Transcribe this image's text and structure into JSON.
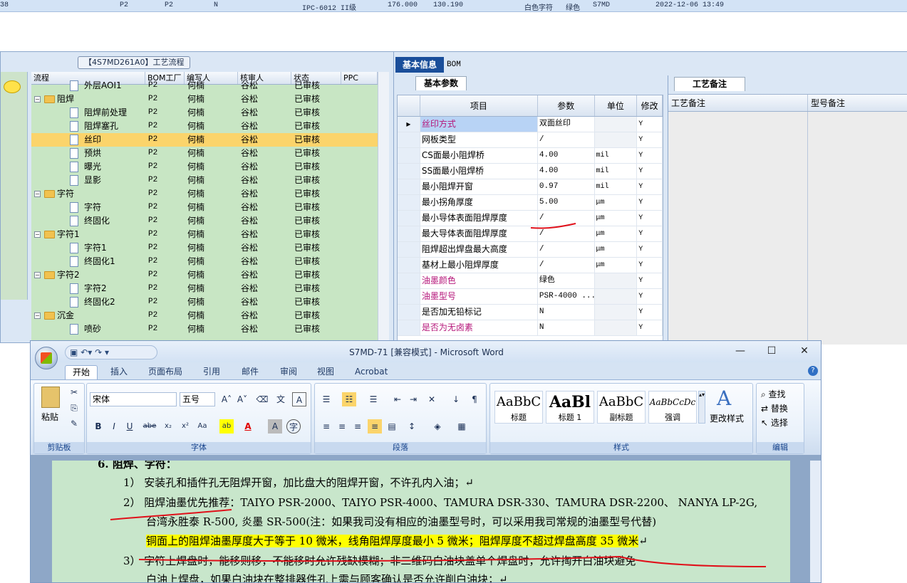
{
  "top_strip": {
    "cells": [
      "38",
      "P2",
      "P2",
      "N",
      "IPC-6012 II级",
      "176.000",
      "130.190",
      "白色字符",
      "绿色",
      "S7MD",
      "2022-12-06 13:49"
    ]
  },
  "flow_panel": {
    "title": "【4S7MD261A0】工艺流程",
    "columns": [
      "流程",
      "BOM工厂",
      "编写人",
      "核审人",
      "状态",
      "PPC"
    ],
    "rows": [
      {
        "name": "外层AOI1",
        "level": 2,
        "type": "doc",
        "bom": "P2",
        "writer": "何楠",
        "reviewer": "谷松",
        "status": "已审核"
      },
      {
        "name": "阻焊",
        "level": 1,
        "type": "folder",
        "bom": "P2",
        "writer": "何楠",
        "reviewer": "谷松",
        "status": "已审核"
      },
      {
        "name": "阻焊前处理",
        "level": 2,
        "type": "doc",
        "bom": "P2",
        "writer": "何楠",
        "reviewer": "谷松",
        "status": "已审核"
      },
      {
        "name": "阻焊塞孔",
        "level": 2,
        "type": "doc",
        "bom": "P2",
        "writer": "何楠",
        "reviewer": "谷松",
        "status": "已审核"
      },
      {
        "name": "丝印",
        "level": 2,
        "type": "doc",
        "bom": "P2",
        "writer": "何楠",
        "reviewer": "谷松",
        "status": "已审核",
        "selected": true
      },
      {
        "name": "预烘",
        "level": 2,
        "type": "doc",
        "bom": "P2",
        "writer": "何楠",
        "reviewer": "谷松",
        "status": "已审核"
      },
      {
        "name": "曝光",
        "level": 2,
        "type": "doc",
        "bom": "P2",
        "writer": "何楠",
        "reviewer": "谷松",
        "status": "已审核"
      },
      {
        "name": "显影",
        "level": 2,
        "type": "doc",
        "bom": "P2",
        "writer": "何楠",
        "reviewer": "谷松",
        "status": "已审核"
      },
      {
        "name": "字符",
        "level": 1,
        "type": "folder",
        "bom": "P2",
        "writer": "何楠",
        "reviewer": "谷松",
        "status": "已审核"
      },
      {
        "name": "字符",
        "level": 2,
        "type": "doc",
        "bom": "P2",
        "writer": "何楠",
        "reviewer": "谷松",
        "status": "已审核"
      },
      {
        "name": "终固化",
        "level": 2,
        "type": "doc",
        "bom": "P2",
        "writer": "何楠",
        "reviewer": "谷松",
        "status": "已审核"
      },
      {
        "name": "字符1",
        "level": 1,
        "type": "folder",
        "bom": "P2",
        "writer": "何楠",
        "reviewer": "谷松",
        "status": "已审核"
      },
      {
        "name": "字符1",
        "level": 2,
        "type": "doc",
        "bom": "P2",
        "writer": "何楠",
        "reviewer": "谷松",
        "status": "已审核"
      },
      {
        "name": "终固化1",
        "level": 2,
        "type": "doc",
        "bom": "P2",
        "writer": "何楠",
        "reviewer": "谷松",
        "status": "已审核"
      },
      {
        "name": "字符2",
        "level": 1,
        "type": "folder",
        "bom": "P2",
        "writer": "何楠",
        "reviewer": "谷松",
        "status": "已审核"
      },
      {
        "name": "字符2",
        "level": 2,
        "type": "doc",
        "bom": "P2",
        "writer": "何楠",
        "reviewer": "谷松",
        "status": "已审核"
      },
      {
        "name": "终固化2",
        "level": 2,
        "type": "doc",
        "bom": "P2",
        "writer": "何楠",
        "reviewer": "谷松",
        "status": "已审核"
      },
      {
        "name": "沉金",
        "level": 1,
        "type": "folder",
        "bom": "P2",
        "writer": "何楠",
        "reviewer": "谷松",
        "status": "已审核"
      },
      {
        "name": "喷砂",
        "level": 2,
        "type": "doc",
        "bom": "P2",
        "writer": "何楠",
        "reviewer": "谷松",
        "status": "已审核"
      }
    ]
  },
  "info_panel": {
    "tabs": [
      "基本信息",
      "BOM"
    ],
    "subtab": "基本参数",
    "columns": [
      "项目",
      "参数",
      "单位",
      "修改"
    ],
    "rows": [
      {
        "item": "丝印方式",
        "value": "双面丝印",
        "unit": "",
        "mod": "Y",
        "pink": true,
        "current": true
      },
      {
        "item": "网板类型",
        "value": "/",
        "unit": "",
        "mod": "Y"
      },
      {
        "item": "CS面最小阻焊桥",
        "value": "4.00",
        "unit": "mil",
        "mod": "Y"
      },
      {
        "item": "SS面最小阻焊桥",
        "value": "4.00",
        "unit": "mil",
        "mod": "Y"
      },
      {
        "item": "最小阻焊开窗",
        "value": "0.97",
        "unit": "mil",
        "mod": "Y"
      },
      {
        "item": "最小拐角厚度",
        "value": "5.00",
        "unit": "μm",
        "mod": "Y"
      },
      {
        "item": "最小导体表面阻焊厚度",
        "value": "/",
        "unit": "μm",
        "mod": "Y"
      },
      {
        "item": "最大导体表面阻焊厚度",
        "value": "/",
        "unit": "μm",
        "mod": "Y"
      },
      {
        "item": "阻焊超出焊盘最大高度",
        "value": "/",
        "unit": "μm",
        "mod": "Y"
      },
      {
        "item": "基材上最小阻焊厚度",
        "value": "/",
        "unit": "μm",
        "mod": "Y"
      },
      {
        "item": "油墨颜色",
        "value": "绿色",
        "unit": "",
        "mod": "Y",
        "pink": true
      },
      {
        "item": "油墨型号",
        "value": "PSR-4000 ...",
        "unit": "",
        "mod": "Y",
        "pink": true
      },
      {
        "item": "是否加无铅标记",
        "value": "N",
        "unit": "",
        "mod": "Y"
      },
      {
        "item": "是否为无卤素",
        "value": "N",
        "unit": "",
        "mod": "Y",
        "pink": true
      }
    ],
    "notes_tab": "工艺备注",
    "notes_columns": [
      "工艺备注",
      "型号备注"
    ]
  },
  "word": {
    "title": "S7MD-71 [兼容模式] - Microsoft Word",
    "tabs": [
      "开始",
      "插入",
      "页面布局",
      "引用",
      "邮件",
      "审阅",
      "视图",
      "Acrobat"
    ],
    "font_name": "宋体",
    "font_size": "五号",
    "groups": {
      "clipboard": "剪贴板",
      "font": "字体",
      "paragraph": "段落",
      "styles": "样式",
      "editing": "编辑"
    },
    "paste_label": "粘贴",
    "styles": [
      {
        "preview": "AaBbC",
        "label": "标题"
      },
      {
        "preview": "AaBl",
        "label": "标题 1"
      },
      {
        "preview": "AaBbC",
        "label": "副标题"
      },
      {
        "preview": "AaBbCcDc",
        "label": "强调"
      }
    ],
    "change_styles": "更改样式",
    "editing": [
      "查找",
      "替换",
      "选择"
    ],
    "doc_lines": {
      "heading": "6.   阻焊、字符：",
      "l1": "1）  安装孔和插件孔无阻焊开窗，加比盘大的阻焊开窗，不许孔内入油；↵",
      "l2": "2）  阻焊油墨优先推荐：TAIYO PSR-2000、TAIYO PSR-4000、TAMURA   DSR-330、TAMURA DSR-2200、 NANYA LP-2G,",
      "l3": "台湾永胜泰 R-500, 炎墨 SR-500(注：如果我司没有相应的油墨型号时，可以采用我司常规的油墨型号代替)",
      "l4": "铜面上的阻焊油墨厚度大于等于 10 微米，线角阻焊厚度最小 5 微米；阻焊厚度不超过焊盘高度 35 微米",
      "l4_end": "↵",
      "l5": "3）  字符上焊盘时，能移则移，不能移时允许残缺模糊；非二维码白油块盖单个焊盘时，允许掏开白油块避免",
      "l6": "白油上焊盘，如果白油块在整排器件孔上需与顾客确认是否允许削白油块；↵"
    }
  },
  "colors": {
    "accent": "#1a4e9a",
    "highlight": "#ffff00",
    "tree_bg": "#c8e6c4",
    "selected": "#fbd46b",
    "pink_text": "#b5167a",
    "annotation": "#e0101a"
  }
}
